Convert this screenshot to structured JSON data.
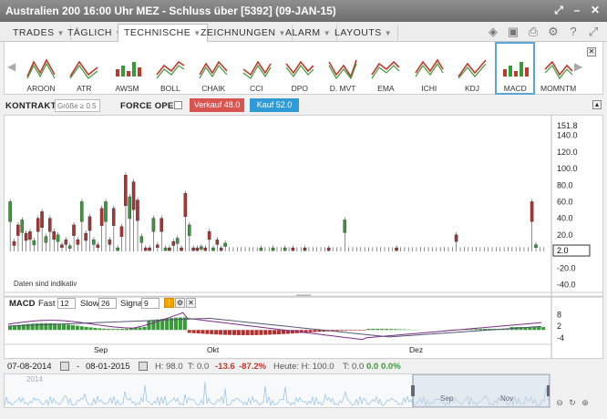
{
  "window": {
    "title": "Australien 200 16:00 Uhr MEZ - Schluss über [5392] (09-JAN-15)"
  },
  "title_icons": [
    "expand-icon",
    "minimize-icon",
    "close-icon"
  ],
  "tabs": [
    {
      "label": "TRADES",
      "active": false
    },
    {
      "label": "TÄGLICH",
      "active": false
    },
    {
      "label": "TECHNISCHE",
      "active": true
    },
    {
      "label": "ZEICHNUNGEN",
      "active": false
    },
    {
      "label": "ALARM",
      "active": false
    },
    {
      "label": "LAYOUTS",
      "active": false
    }
  ],
  "toolbar_icons": [
    "layers-icon",
    "image-icon",
    "print-icon",
    "gear-icon",
    "help-icon",
    "fullscreen-icon"
  ],
  "indicators": [
    {
      "label": "AROON",
      "icon": "aroon-icon",
      "active": false
    },
    {
      "label": "ATR",
      "icon": "atr-icon",
      "active": false
    },
    {
      "label": "AWSM",
      "icon": "awsm-icon",
      "active": false
    },
    {
      "label": "BOLL",
      "icon": "boll-icon",
      "active": false
    },
    {
      "label": "CHAIK",
      "icon": "chaik-icon",
      "active": false
    },
    {
      "label": "CCI",
      "icon": "cci-icon",
      "active": false
    },
    {
      "label": "DPO",
      "icon": "dpo-icon",
      "active": false
    },
    {
      "label": "D. MVT",
      "icon": "dmvt-icon",
      "active": false
    },
    {
      "label": "EMA",
      "icon": "ema-icon",
      "active": false
    },
    {
      "label": "ICHI",
      "icon": "ichi-icon",
      "active": false
    },
    {
      "label": "KDJ",
      "icon": "kdj-icon",
      "active": false
    },
    {
      "label": "MACD",
      "icon": "macd-icon",
      "active": true
    },
    {
      "label": "MOMNTM",
      "icon": "momntm-icon",
      "active": false
    }
  ],
  "controls": {
    "kontrakte_label": "KONTRAKTE",
    "size_placeholder": "Größe ≥ 0.5",
    "force_open_label": "FORCE OPEN",
    "sell_label": "Verkauf 48.0",
    "buy_label": "Kauf 52.0"
  },
  "colors": {
    "up": "#3a9a3a",
    "down": "#c0392b",
    "macd_line": "#7b2d86",
    "signal_line": "#555577",
    "accent": "#2e9bd6"
  },
  "chart_data": [
    {
      "type": "bar",
      "title": "",
      "note": "Daten sind indikativ",
      "y_ticks": [
        "151.8",
        "140.0",
        "120.0",
        "100.0",
        "80.0",
        "60.0",
        "40.0",
        "20.0",
        "2.0",
        "-20.0",
        "-40.0"
      ],
      "current_value": "2.0",
      "ylim": [
        -45,
        155
      ],
      "values": [
        60,
        12,
        32,
        38,
        22,
        24,
        13,
        40,
        48,
        18,
        40,
        24,
        20,
        8,
        14,
        7,
        32,
        14,
        60,
        22,
        42,
        14,
        8,
        52,
        60,
        14,
        52,
        4,
        30,
        92,
        66,
        84,
        62,
        18,
        4,
        4,
        40,
        8,
        40,
        4,
        4,
        12,
        16,
        4,
        70,
        32,
        4,
        4,
        6,
        4,
        24,
        4,
        14,
        4,
        10,
        2,
        2,
        2,
        2,
        2,
        2,
        2,
        2,
        4,
        2,
        2,
        4,
        2,
        2,
        4,
        2,
        4,
        2,
        2,
        4,
        2,
        2,
        2,
        2,
        2,
        4,
        2,
        2,
        2,
        38,
        2,
        2,
        2,
        2,
        2,
        2,
        2,
        2,
        2,
        2,
        2,
        2,
        4,
        2,
        2,
        2,
        2,
        2,
        2,
        2,
        2,
        2,
        2,
        2,
        2,
        2,
        2,
        20,
        2,
        2,
        2,
        2,
        2,
        2,
        2,
        2,
        2,
        2,
        2,
        2,
        2,
        2,
        2,
        2,
        2,
        2,
        60,
        8,
        2,
        2
      ]
    },
    {
      "type": "bar",
      "title": "MACD",
      "params": {
        "fast_label": "Fast",
        "fast": "12",
        "slow_label": "Slow",
        "slow": "26",
        "signal_label": "Signal",
        "signal": "9"
      },
      "y_ticks": [
        "8",
        "2",
        "-4"
      ],
      "ylim": [
        -6,
        10
      ],
      "x_ticks": [
        "Sep",
        "Okt",
        "Dez"
      ]
    }
  ],
  "status": {
    "from_date": "07-08-2014",
    "to_date": "08-01-2015",
    "h": "H: 98.0",
    "t": "T: 0.0",
    "change": "-13.6",
    "change_pct": "-87.2%",
    "heute": "Heute: H: 100.0",
    "heute_t": "T: 0.0",
    "heute_change": "0.0",
    "heute_pct": "0.0%"
  },
  "navigator": {
    "labels": [
      "2014",
      "Sep",
      "Nov"
    ]
  }
}
